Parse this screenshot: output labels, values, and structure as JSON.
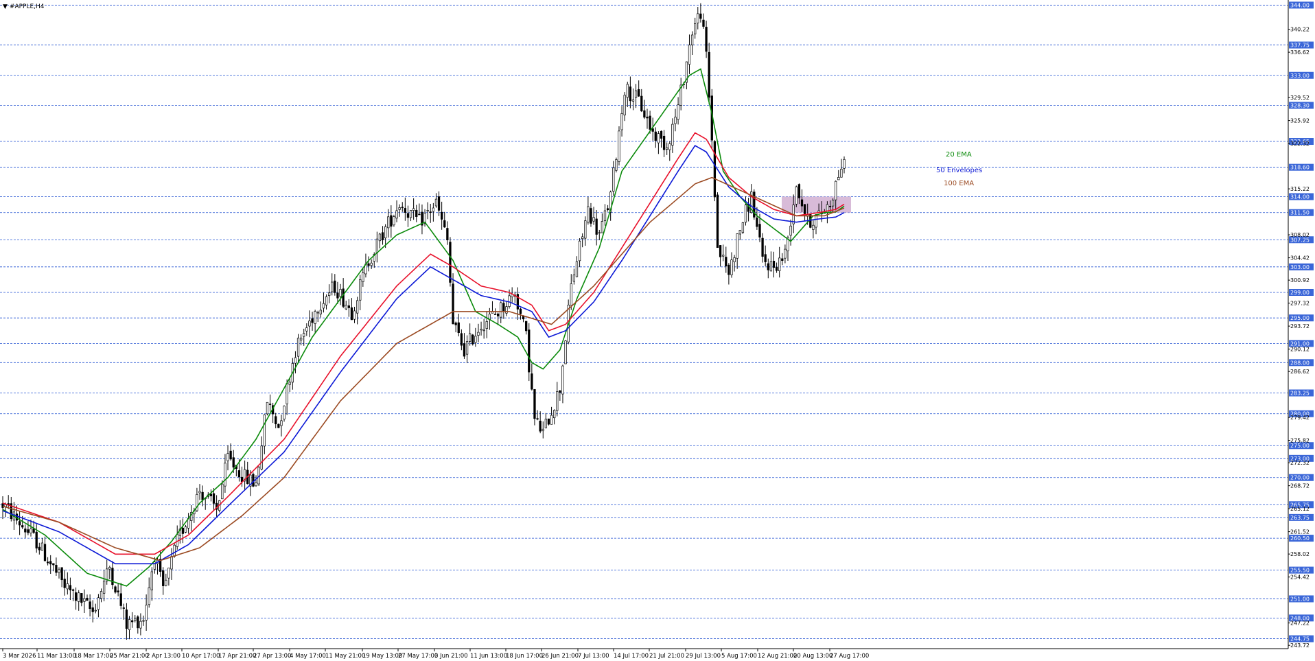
{
  "window": {
    "title": "#APPLE,H4",
    "title_marker": "▼"
  },
  "colors": {
    "background": "#ffffff",
    "level_line": "#1f4fd1",
    "level_badge": "#3a66d8",
    "candle": "#000000",
    "ema20": "#0a8a0a",
    "env_upper": "#e8102a",
    "env_lower": "#0b18d6",
    "ema100": "#9b4a22",
    "zone_fill": "#d4b4d4"
  },
  "chart_data": {
    "type": "candlestick",
    "symbol": "#APPLE",
    "timeframe": "H4",
    "ylim": [
      243.2,
      344.8
    ],
    "grid": false,
    "x_tick_labels": [
      "3 Mar 2026",
      "11 Mar 13:00",
      "18 Mar 17:00",
      "25 Mar 21:00",
      "2 Apr 13:00",
      "10 Apr 17:00",
      "17 Apr 21:00",
      "27 Apr 13:00",
      "4 May 17:00",
      "11 May 21:00",
      "19 May 13:00",
      "27 May 17:00",
      "3 Jun 21:00",
      "11 Jun 13:00",
      "18 Jun 17:00",
      "26 Jun 21:00",
      "7 Jul 13:00",
      "14 Jul 17:00",
      "21 Jul 21:00",
      "29 Jul 13:00",
      "5 Aug 17:00",
      "12 Aug 21:00",
      "20 Aug 13:00",
      "27 Aug 17:00"
    ],
    "y_axis_ticks": [
      "340.22",
      "336.62",
      "329.52",
      "325.92",
      "322.32",
      "315.22",
      "308.02",
      "304.42",
      "300.92",
      "297.32",
      "293.72",
      "290.12",
      "286.62",
      "279.42",
      "275.82",
      "272.32",
      "268.72",
      "265.12",
      "261.52",
      "258.02",
      "254.42",
      "247.22",
      "243.72"
    ],
    "horizontal_levels": [
      "344.00",
      "337.75",
      "333.00",
      "328.30",
      "322.65",
      "318.60",
      "314.00",
      "311.50",
      "307.25",
      "303.00",
      "299.00",
      "295.00",
      "291.00",
      "288.00",
      "283.25",
      "280.00",
      "275.00",
      "273.00",
      "270.00",
      "265.75",
      "263.75",
      "260.50",
      "255.50",
      "251.00",
      "248.00",
      "244.75"
    ],
    "zone": {
      "price_top": 314.0,
      "price_bottom": 311.5
    },
    "annotations": [
      {
        "text": "20 EMA",
        "series": "ema20"
      },
      {
        "text": "50 Envelopes",
        "series": "envelopes"
      },
      {
        "text": "100 EMA",
        "series": "ema100"
      }
    ],
    "price_path": {
      "bar_count": 300,
      "anchors": [
        [
          0,
          265.8
        ],
        [
          12,
          260
        ],
        [
          22,
          253
        ],
        [
          32,
          249
        ],
        [
          38,
          256
        ],
        [
          44,
          247
        ],
        [
          50,
          248
        ],
        [
          54,
          258
        ],
        [
          57,
          252
        ],
        [
          62,
          260
        ],
        [
          70,
          268
        ],
        [
          76,
          265
        ],
        [
          80,
          273
        ],
        [
          86,
          270
        ],
        [
          90,
          269
        ],
        [
          94,
          282
        ],
        [
          98,
          278
        ],
        [
          104,
          290
        ],
        [
          112,
          297
        ],
        [
          118,
          300
        ],
        [
          124,
          296
        ],
        [
          130,
          304
        ],
        [
          136,
          309
        ],
        [
          141,
          313
        ],
        [
          148,
          310
        ],
        [
          154,
          313
        ],
        [
          158,
          307
        ],
        [
          160,
          294
        ],
        [
          164,
          290
        ],
        [
          170,
          294
        ],
        [
          176,
          296
        ],
        [
          182,
          299
        ],
        [
          186,
          292
        ],
        [
          189,
          279
        ],
        [
          192,
          277
        ],
        [
          198,
          284
        ],
        [
          202,
          300
        ],
        [
          208,
          312
        ],
        [
          212,
          308
        ],
        [
          216,
          314
        ],
        [
          221,
          331
        ],
        [
          226,
          329
        ],
        [
          231,
          324
        ],
        [
          236,
          322
        ],
        [
          240,
          328
        ],
        [
          245,
          340
        ],
        [
          248,
          343
        ],
        [
          250,
          336
        ],
        [
          252,
          323
        ],
        [
          254,
          306
        ],
        [
          258,
          302
        ],
        [
          262,
          309
        ],
        [
          266,
          314
        ],
        [
          270,
          304
        ],
        [
          274,
          303
        ],
        [
          278,
          305
        ],
        [
          282,
          316
        ],
        [
          286,
          310
        ],
        [
          290,
          311
        ],
        [
          294,
          313
        ],
        [
          298,
          319
        ],
        [
          299,
          318.6
        ]
      ]
    },
    "series": [
      {
        "key": "ema20",
        "name": "20 EMA",
        "anchors": [
          [
            0,
            265
          ],
          [
            15,
            261
          ],
          [
            30,
            255
          ],
          [
            44,
            253
          ],
          [
            52,
            256
          ],
          [
            60,
            260
          ],
          [
            70,
            266
          ],
          [
            80,
            270
          ],
          [
            90,
            276
          ],
          [
            100,
            284
          ],
          [
            110,
            292
          ],
          [
            120,
            298
          ],
          [
            130,
            304
          ],
          [
            140,
            308
          ],
          [
            150,
            310
          ],
          [
            160,
            304
          ],
          [
            168,
            296
          ],
          [
            176,
            294
          ],
          [
            183,
            292
          ],
          [
            188,
            288
          ],
          [
            192,
            287
          ],
          [
            198,
            290
          ],
          [
            204,
            298
          ],
          [
            212,
            306
          ],
          [
            220,
            318
          ],
          [
            228,
            323
          ],
          [
            236,
            328
          ],
          [
            244,
            333
          ],
          [
            248,
            334
          ],
          [
            252,
            327
          ],
          [
            256,
            318
          ],
          [
            262,
            314
          ],
          [
            268,
            311
          ],
          [
            274,
            309
          ],
          [
            280,
            307
          ],
          [
            284,
            309
          ],
          [
            288,
            311
          ],
          [
            292,
            311.5
          ],
          [
            296,
            311.6
          ],
          [
            299,
            312.5
          ]
        ]
      },
      {
        "key": "env_upper",
        "name": "50 Envelopes upper",
        "anchors": [
          [
            0,
            266
          ],
          [
            20,
            263
          ],
          [
            40,
            258
          ],
          [
            54,
            258
          ],
          [
            66,
            261
          ],
          [
            80,
            267
          ],
          [
            100,
            276
          ],
          [
            120,
            289
          ],
          [
            140,
            300
          ],
          [
            152,
            305
          ],
          [
            160,
            303
          ],
          [
            170,
            300
          ],
          [
            180,
            299
          ],
          [
            188,
            297
          ],
          [
            194,
            293
          ],
          [
            200,
            294
          ],
          [
            210,
            299
          ],
          [
            220,
            306
          ],
          [
            230,
            313
          ],
          [
            240,
            320
          ],
          [
            246,
            324
          ],
          [
            250,
            323
          ],
          [
            258,
            317
          ],
          [
            266,
            314
          ],
          [
            274,
            312
          ],
          [
            282,
            311
          ],
          [
            290,
            311.5
          ],
          [
            296,
            312
          ],
          [
            299,
            312.8
          ]
        ]
      },
      {
        "key": "env_lower",
        "name": "50 Envelopes lower",
        "anchors": [
          [
            0,
            264.8
          ],
          [
            20,
            261.5
          ],
          [
            40,
            256.5
          ],
          [
            54,
            256.5
          ],
          [
            66,
            259.5
          ],
          [
            80,
            265.5
          ],
          [
            100,
            274
          ],
          [
            120,
            286.5
          ],
          [
            140,
            298
          ],
          [
            152,
            303
          ],
          [
            160,
            301
          ],
          [
            170,
            298.5
          ],
          [
            180,
            297.5
          ],
          [
            188,
            296
          ],
          [
            194,
            292
          ],
          [
            200,
            293
          ],
          [
            210,
            297.5
          ],
          [
            220,
            304
          ],
          [
            230,
            311
          ],
          [
            240,
            318
          ],
          [
            246,
            322
          ],
          [
            250,
            321
          ],
          [
            258,
            315.5
          ],
          [
            266,
            312.5
          ],
          [
            274,
            310.5
          ],
          [
            282,
            310
          ],
          [
            290,
            310.5
          ],
          [
            296,
            310.8
          ],
          [
            299,
            311.5
          ]
        ]
      },
      {
        "key": "ema100",
        "name": "100 EMA",
        "anchors": [
          [
            0,
            265.5
          ],
          [
            20,
            263
          ],
          [
            40,
            259
          ],
          [
            56,
            257
          ],
          [
            70,
            259
          ],
          [
            85,
            264
          ],
          [
            100,
            270
          ],
          [
            120,
            282
          ],
          [
            140,
            291
          ],
          [
            160,
            296
          ],
          [
            180,
            296
          ],
          [
            195,
            294
          ],
          [
            210,
            300
          ],
          [
            230,
            310
          ],
          [
            246,
            316
          ],
          [
            252,
            317
          ],
          [
            262,
            315
          ],
          [
            272,
            313
          ],
          [
            282,
            311
          ],
          [
            292,
            311
          ],
          [
            299,
            312.2
          ]
        ]
      }
    ]
  }
}
